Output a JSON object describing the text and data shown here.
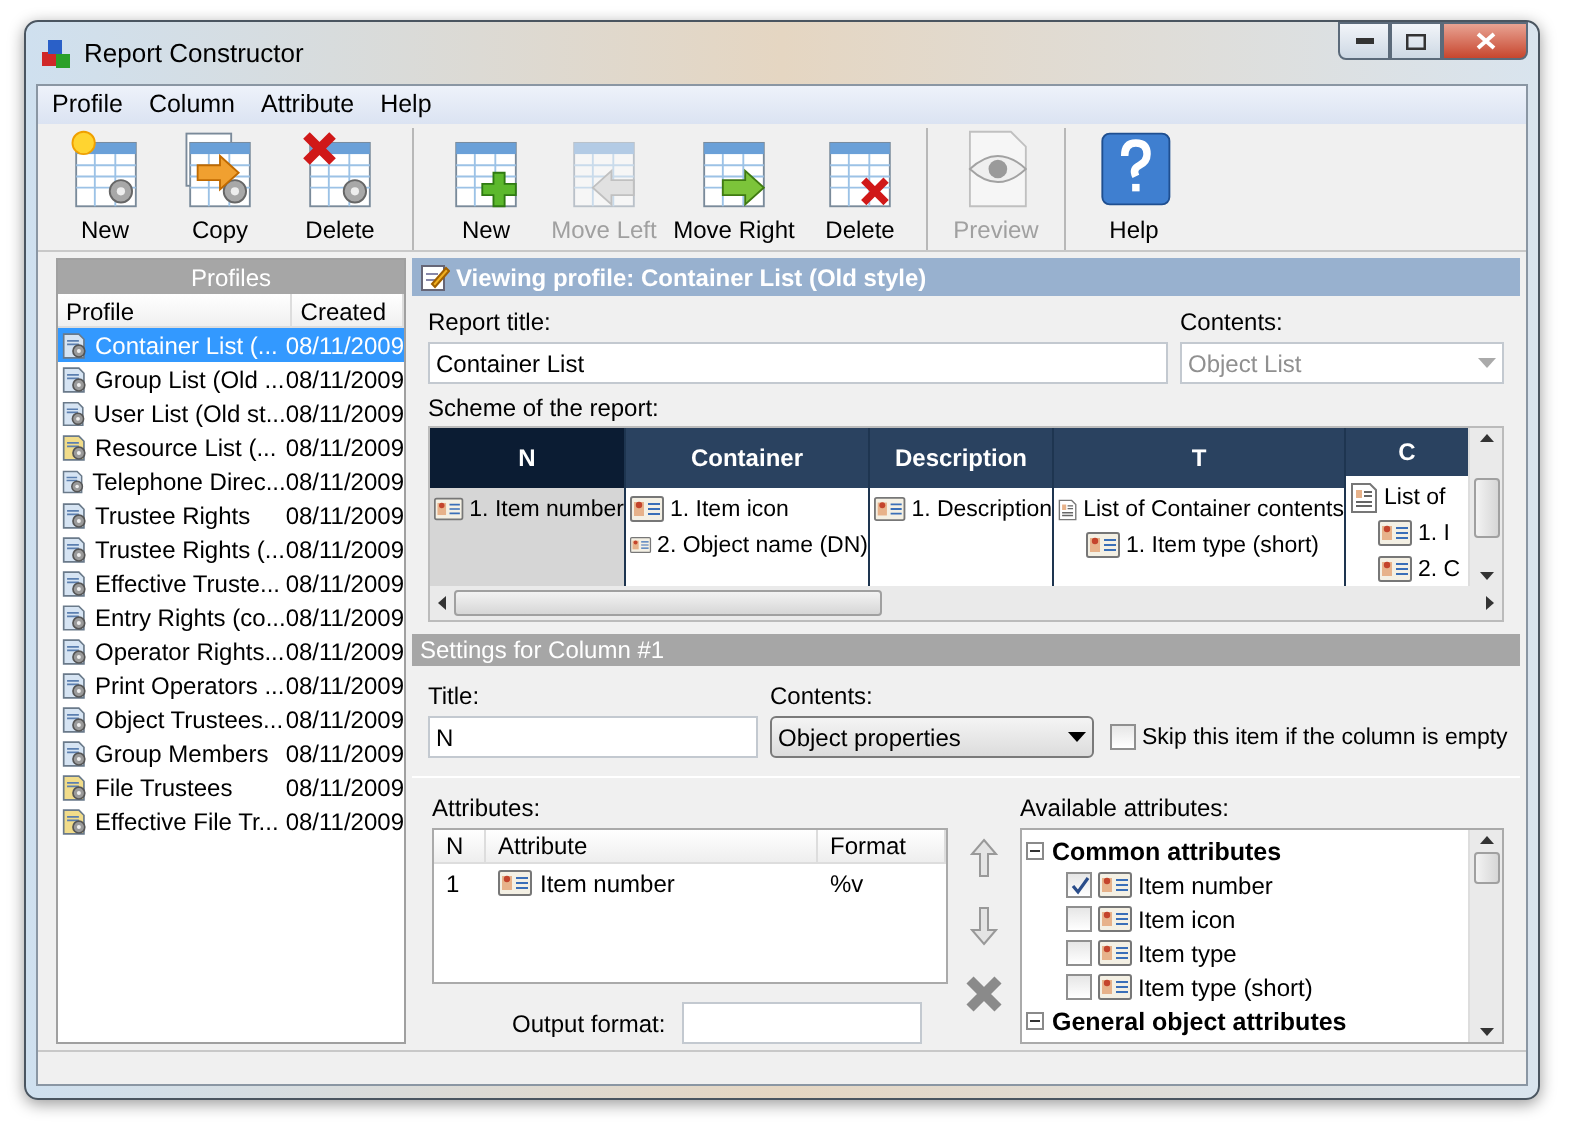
{
  "window": {
    "title": "Report Constructor"
  },
  "menu": [
    {
      "label": "Profile"
    },
    {
      "label": "Column"
    },
    {
      "label": "Attribute"
    },
    {
      "label": "Help"
    }
  ],
  "toolbar": [
    {
      "items": [
        {
          "kind": "new-profile",
          "label": "New",
          "disabled": false
        },
        {
          "kind": "copy-profile",
          "label": "Copy",
          "disabled": false
        },
        {
          "kind": "delete-profile",
          "label": "Delete",
          "disabled": false
        }
      ]
    },
    {
      "items": [
        {
          "kind": "new-column",
          "label": "New",
          "disabled": false
        },
        {
          "kind": "move-left",
          "label": "Move Left",
          "disabled": true
        },
        {
          "kind": "move-right",
          "label": "Move Right",
          "disabled": false
        },
        {
          "kind": "delete-column",
          "label": "Delete",
          "disabled": false
        }
      ]
    },
    {
      "items": [
        {
          "kind": "preview",
          "label": "Preview",
          "disabled": true
        }
      ]
    },
    {
      "items": [
        {
          "kind": "help",
          "label": "Help",
          "disabled": false
        }
      ]
    }
  ],
  "profiles": {
    "title": "Profiles",
    "columns": [
      "Profile",
      "Created"
    ],
    "rows": [
      {
        "name": "Container List (...",
        "created": "08/11/2009",
        "selected": true,
        "kind": "report"
      },
      {
        "name": "Group List (Old ...",
        "created": "08/11/2009",
        "selected": false,
        "kind": "report"
      },
      {
        "name": "User List (Old st...",
        "created": "08/11/2009",
        "selected": false,
        "kind": "report"
      },
      {
        "name": "Resource List (...",
        "created": "08/11/2009",
        "selected": false,
        "kind": "folder"
      },
      {
        "name": "Telephone Direc...",
        "created": "08/11/2009",
        "selected": false,
        "kind": "report"
      },
      {
        "name": "Trustee Rights",
        "created": "08/11/2009",
        "selected": false,
        "kind": "report"
      },
      {
        "name": "Trustee Rights (...",
        "created": "08/11/2009",
        "selected": false,
        "kind": "report"
      },
      {
        "name": "Effective Truste...",
        "created": "08/11/2009",
        "selected": false,
        "kind": "report"
      },
      {
        "name": "Entry Rights (co...",
        "created": "08/11/2009",
        "selected": false,
        "kind": "report"
      },
      {
        "name": "Operator Rights...",
        "created": "08/11/2009",
        "selected": false,
        "kind": "report"
      },
      {
        "name": "Print Operators ...",
        "created": "08/11/2009",
        "selected": false,
        "kind": "report"
      },
      {
        "name": "Object Trustees...",
        "created": "08/11/2009",
        "selected": false,
        "kind": "report"
      },
      {
        "name": "Group Members",
        "created": "08/11/2009",
        "selected": false,
        "kind": "report"
      },
      {
        "name": "File Trustees",
        "created": "08/11/2009",
        "selected": false,
        "kind": "folder"
      },
      {
        "name": "Effective File Tr...",
        "created": "08/11/2009",
        "selected": false,
        "kind": "folder"
      }
    ]
  },
  "viewing": {
    "title": "Viewing profile: Container List (Old style)"
  },
  "report_title": {
    "label": "Report title:",
    "value": "Container List"
  },
  "contents": {
    "label": "Contents:",
    "value": "Object List",
    "disabled": true
  },
  "scheme": {
    "label": "Scheme of the report:",
    "columns": [
      {
        "title": "N",
        "selected": true,
        "items": [
          {
            "kind": "attribute",
            "label": "1. Item number"
          }
        ]
      },
      {
        "title": "Container",
        "selected": false,
        "items": [
          {
            "kind": "attribute",
            "label": "1. Item icon"
          },
          {
            "kind": "attribute",
            "label": "2. Object name (DN)"
          }
        ]
      },
      {
        "title": "Description",
        "selected": false,
        "items": [
          {
            "kind": "attribute",
            "label": "1. Description"
          }
        ]
      },
      {
        "title": "T",
        "selected": false,
        "items": [
          {
            "kind": "list",
            "label": "List of Container contents",
            "children": [
              {
                "kind": "attribute",
                "label": "1. Item type (short)"
              }
            ]
          }
        ]
      },
      {
        "title": "C",
        "selected": false,
        "items": [
          {
            "kind": "list",
            "label": "List of",
            "children": [
              {
                "kind": "attribute",
                "label": "1. I"
              },
              {
                "kind": "attribute",
                "label": "2. C"
              }
            ]
          }
        ]
      }
    ]
  },
  "settings": {
    "title": "Settings for Column #1",
    "column_title": {
      "label": "Title:",
      "value": "N"
    },
    "contents": {
      "label": "Contents:",
      "value": "Object properties"
    },
    "skip": {
      "label": "Skip this item if the column is empty",
      "checked": false
    }
  },
  "attributes": {
    "label": "Attributes:",
    "columns": [
      "N",
      "Attribute",
      "Format"
    ],
    "rows": [
      {
        "n": "1",
        "attribute": "Item number",
        "format": "%v"
      }
    ],
    "output_format": {
      "label": "Output format:"
    }
  },
  "available": {
    "label": "Available attributes:",
    "groups": [
      {
        "name": "Common attributes",
        "expanded": true,
        "items": [
          {
            "label": "Item number",
            "checked": true
          },
          {
            "label": "Item icon",
            "checked": false
          },
          {
            "label": "Item type",
            "checked": false
          },
          {
            "label": "Item type (short)",
            "checked": false
          }
        ]
      },
      {
        "name": "General object attributes",
        "expanded": true
      }
    ]
  }
}
